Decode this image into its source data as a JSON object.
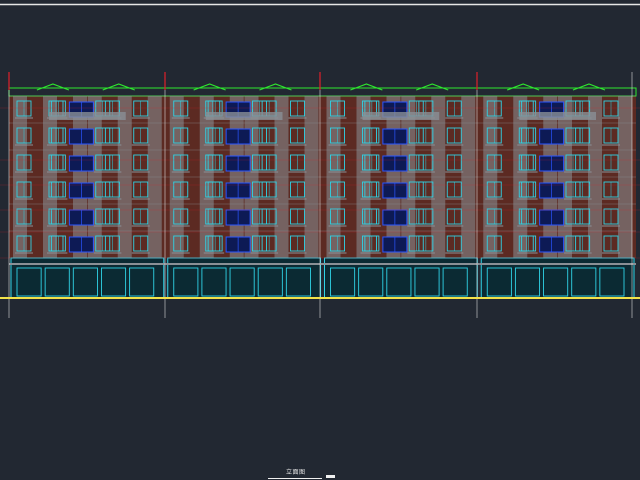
{
  "drawing": {
    "title": "立面图",
    "building": {
      "units": 4,
      "residential_floors": 6,
      "ground_floor": "shopfronts",
      "roof_gables_per_unit": 2
    },
    "colors": {
      "background": "#222832",
      "brick": "#5c2a22",
      "brick_dark": "#4a2019",
      "trim_grey": "#8a9096",
      "window_cyan": "#2fd3e6",
      "window_blue": "#2a55ff",
      "roof_green": "#2ee82e",
      "grid_red": "#e0202a",
      "ground_yellow": "#f2e24a",
      "line_white": "#e6e6e6"
    }
  }
}
